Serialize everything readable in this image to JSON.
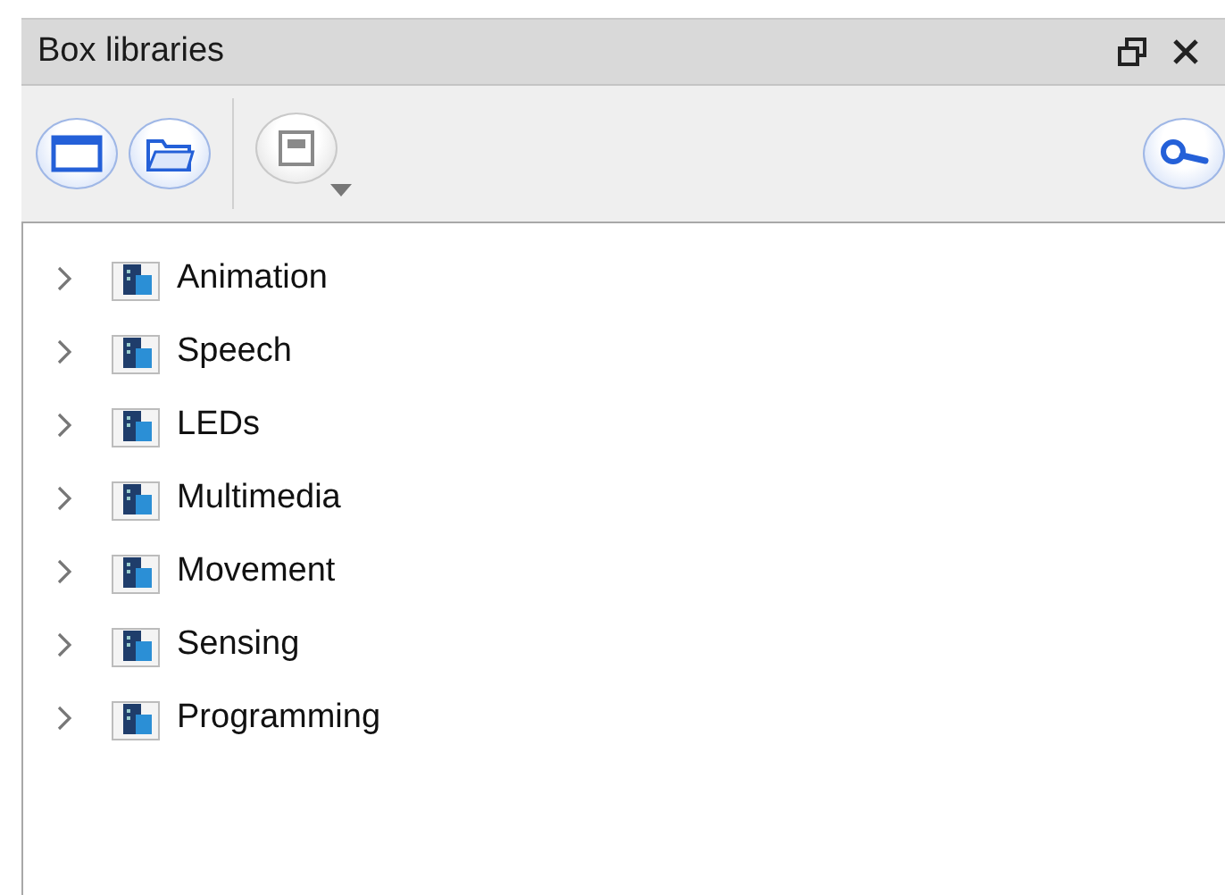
{
  "panel": {
    "title": "Box libraries"
  },
  "toolbar": [
    {
      "kind": "window",
      "disabled": false,
      "dropdown": false
    },
    {
      "kind": "folder",
      "disabled": false,
      "dropdown": false
    },
    {
      "kind": "save",
      "disabled": true,
      "dropdown": true
    },
    {
      "kind": "search",
      "disabled": false,
      "dropdown": false
    }
  ],
  "tree": [
    {
      "label": "Animation",
      "expanded": false
    },
    {
      "label": "Speech",
      "expanded": false
    },
    {
      "label": "LEDs",
      "expanded": false
    },
    {
      "label": "Multimedia",
      "expanded": false
    },
    {
      "label": "Movement",
      "expanded": false
    },
    {
      "label": "Sensing",
      "expanded": false
    },
    {
      "label": "Programming",
      "expanded": false
    }
  ]
}
